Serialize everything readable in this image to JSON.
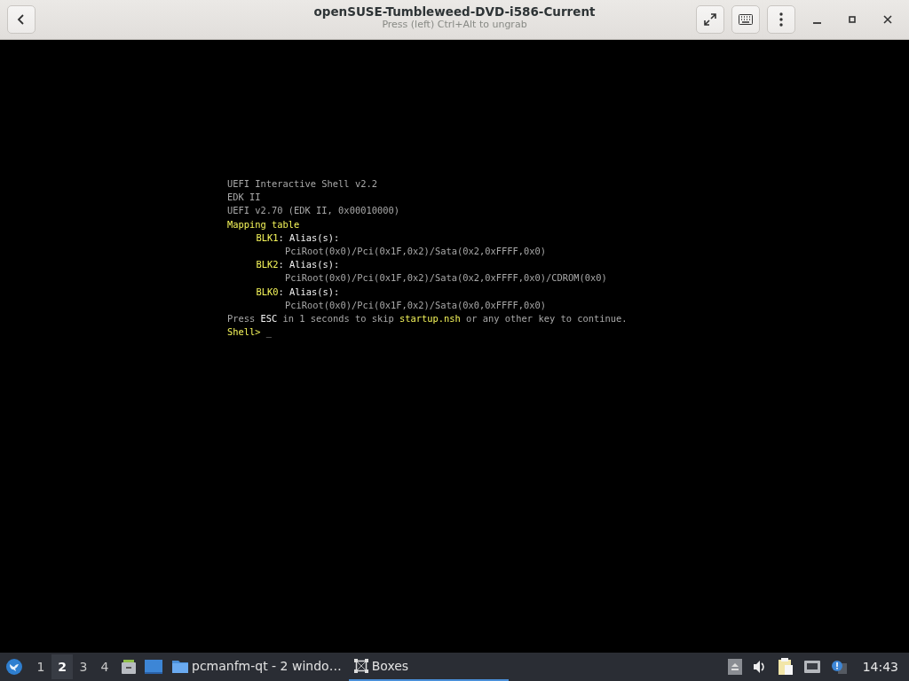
{
  "window": {
    "title": "openSUSE-Tumbleweed-DVD-i586-Current",
    "subtitle": "Press (left) Ctrl+Alt to ungrab"
  },
  "console": {
    "lines": [
      {
        "segments": [
          {
            "text": "UEFI Interactive Shell v2.2",
            "kind": "normal"
          }
        ]
      },
      {
        "segments": [
          {
            "text": "EDK II",
            "kind": "normal"
          }
        ]
      },
      {
        "segments": [
          {
            "text": "UEFI v2.70 (EDK II, 0x00010000)",
            "kind": "normal"
          }
        ]
      },
      {
        "segments": [
          {
            "text": "Mapping table",
            "kind": "yellow"
          }
        ],
        "children": [
          {
            "segments": [
              {
                "text": "BLK1",
                "kind": "yellow"
              },
              {
                "text": ": Alias(s):",
                "kind": "bright"
              }
            ],
            "children": [
              {
                "segments": [
                  {
                    "text": "PciRoot(0x0)/Pci(0x1F,0x2)/Sata(0x2,0xFFFF,0x0)",
                    "kind": "normal"
                  }
                ]
              }
            ]
          },
          {
            "segments": [
              {
                "text": "BLK2",
                "kind": "yellow"
              },
              {
                "text": ": Alias(s):",
                "kind": "bright"
              }
            ],
            "children": [
              {
                "segments": [
                  {
                    "text": "PciRoot(0x0)/Pci(0x1F,0x2)/Sata(0x2,0xFFFF,0x0)/CDROM(0x0)",
                    "kind": "normal"
                  }
                ]
              }
            ]
          },
          {
            "segments": [
              {
                "text": "BLK0",
                "kind": "yellow"
              },
              {
                "text": ": Alias(s):",
                "kind": "bright"
              }
            ],
            "children": [
              {
                "segments": [
                  {
                    "text": "PciRoot(0x0)/Pci(0x1F,0x2)/Sata(0x0,0xFFFF,0x0)",
                    "kind": "normal"
                  }
                ]
              }
            ]
          }
        ]
      },
      {
        "segments": [
          {
            "text": "Press ",
            "kind": "normal"
          },
          {
            "text": "ESC",
            "kind": "bright"
          },
          {
            "text": " in 1 seconds to skip ",
            "kind": "normal"
          },
          {
            "text": "startup.nsh",
            "kind": "yellow"
          },
          {
            "text": " or any other key to continue.",
            "kind": "normal"
          }
        ]
      },
      {
        "segments": [
          {
            "text": "Shell> ",
            "kind": "yellow"
          },
          {
            "text": "_",
            "kind": "normal"
          }
        ]
      }
    ]
  },
  "taskbar": {
    "workspaces": [
      {
        "label": "1",
        "selected": false
      },
      {
        "label": "2",
        "selected": true
      },
      {
        "label": "3",
        "selected": false
      },
      {
        "label": "4",
        "selected": false
      }
    ],
    "tasks": [
      {
        "label": "pcmanfm-qt - 2 windo…",
        "kind": "folder",
        "selected": false
      },
      {
        "label": "Boxes",
        "kind": "boxes",
        "selected": true
      }
    ],
    "clock": "14:43"
  }
}
